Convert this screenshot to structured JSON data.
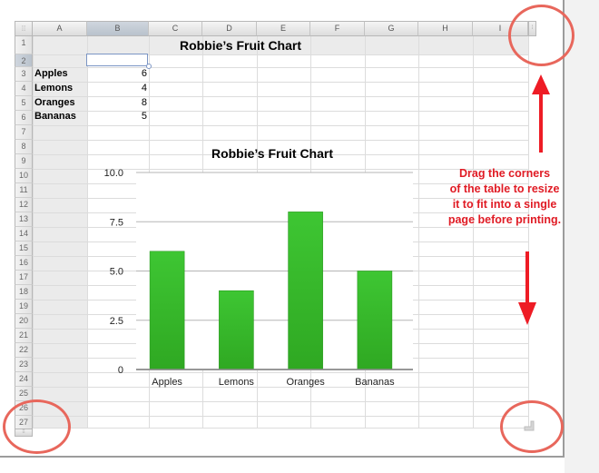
{
  "spreadsheet": {
    "columns": [
      "A",
      "B",
      "C",
      "D",
      "E",
      "F",
      "G",
      "H",
      "I"
    ],
    "selected_column": "B",
    "rows": [
      "1",
      "2",
      "3",
      "4",
      "5",
      "6",
      "7",
      "8",
      "9",
      "10",
      "11",
      "12",
      "13",
      "14",
      "15",
      "16",
      "17",
      "18",
      "19",
      "20",
      "21",
      "22",
      "23",
      "24",
      "25",
      "26",
      "27"
    ],
    "selected_row": "2",
    "table_title": "Robbie’s Fruit Chart",
    "data_rows": [
      {
        "label": "Apples",
        "value": "6"
      },
      {
        "label": "Lemons",
        "value": "4"
      },
      {
        "label": "Oranges",
        "value": "8"
      },
      {
        "label": "Bananas",
        "value": "5"
      }
    ],
    "selected_cell": "B2",
    "handle_icon": "grip-dots-icon",
    "resize_icon": "resize-corner-icon"
  },
  "chart_data": {
    "type": "bar",
    "title": "Robbie’s Fruit Chart",
    "categories": [
      "Apples",
      "Lemons",
      "Oranges",
      "Bananas"
    ],
    "values": [
      6,
      4,
      8,
      5
    ],
    "xlabel": "",
    "ylabel": "",
    "ylim": [
      0,
      10
    ],
    "yticks": [
      0,
      2.5,
      5,
      7.5,
      10
    ],
    "ytick_labels": [
      "0",
      "2.5",
      "5.0",
      "7.5",
      "10.0"
    ],
    "grid": true,
    "legend": "none",
    "bar_color": "#35b52a"
  },
  "annotation": {
    "note": [
      "Drag the corners",
      "of the table to resize",
      "it to fit into a single",
      "page before printing."
    ],
    "color": "#e01b24",
    "circle_color": "#e8675c"
  }
}
